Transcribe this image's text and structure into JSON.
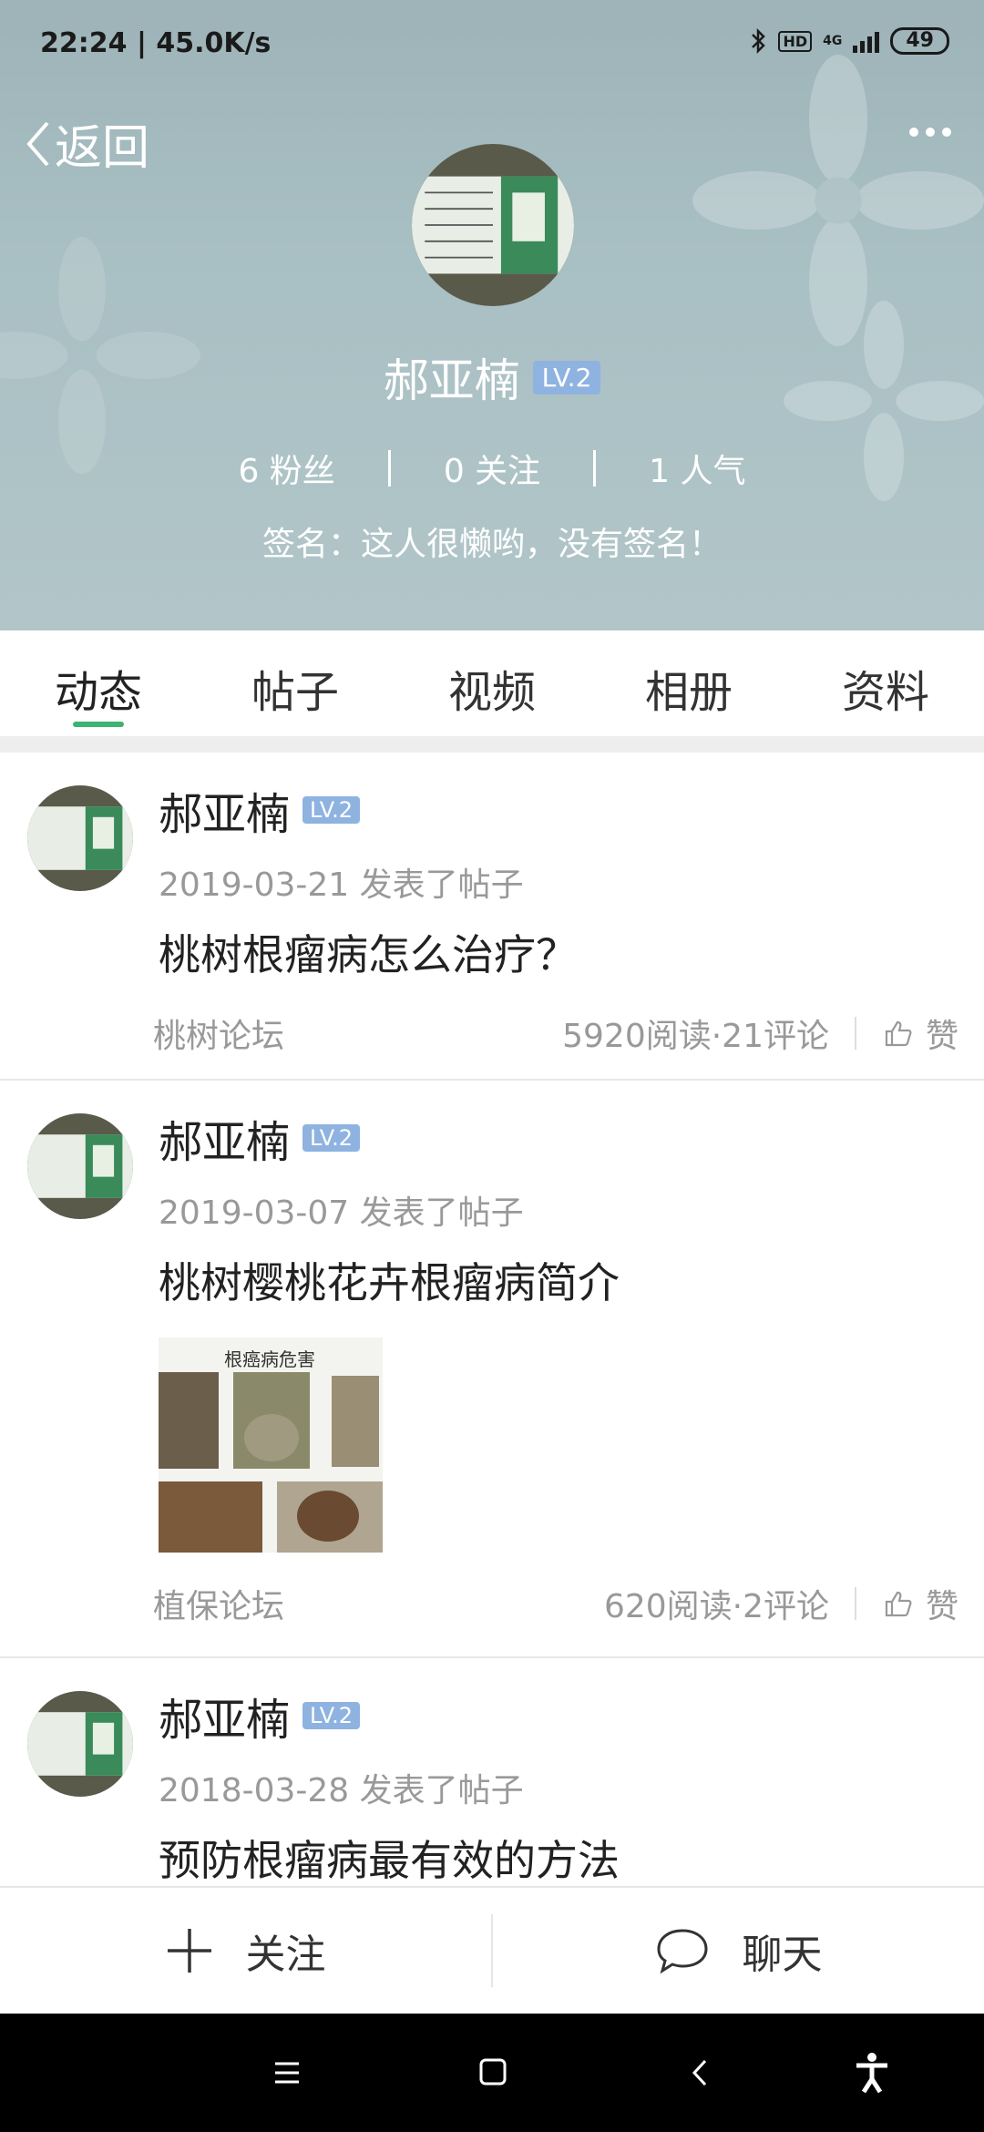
{
  "status_bar": {
    "time": "22:24 | 45.0K/s",
    "battery": "49",
    "network": "4G",
    "hd": "HD"
  },
  "header": {
    "back_label": "返回",
    "name": "郝亚楠",
    "level": "LV.2",
    "stats": [
      "6 粉丝",
      "0 关注",
      "1 人气"
    ],
    "signature": "签名：这人很懒哟，没有签名！"
  },
  "tabs": [
    "动态",
    "帖子",
    "视频",
    "相册",
    "资料"
  ],
  "posts": [
    {
      "author": "郝亚楠",
      "level": "LV.2",
      "meta": "2019-03-21  发表了帖子",
      "title": "桃树根瘤病怎么治疗？",
      "forum": "桃树论坛",
      "stats": "5920阅读·21评论",
      "like": "赞"
    },
    {
      "author": "郝亚楠",
      "level": "LV.2",
      "meta": "2019-03-07  发表了帖子",
      "title": "桃树樱桃花卉根瘤病简介",
      "thumb_caption": "根癌病危害",
      "forum": "植保论坛",
      "stats": "620阅读·2评论",
      "like": "赞"
    },
    {
      "author": "郝亚楠",
      "level": "LV.2",
      "meta": "2018-03-28  发表了帖子",
      "title": "预防根瘤病最有效的方法"
    }
  ],
  "actions": {
    "follow": "关注",
    "chat": "聊天"
  },
  "icons": [
    "bluetooth-icon",
    "signal-icon",
    "back-chevron-icon",
    "more-icon",
    "like-icon",
    "plus-icon",
    "chat-bubble-icon",
    "menu-icon",
    "home-icon",
    "back-icon",
    "accessibility-icon"
  ],
  "colors": {
    "accent": "#3cb371",
    "level_badge": "#8fb3e0",
    "header_bg": "#a8bfc3"
  }
}
